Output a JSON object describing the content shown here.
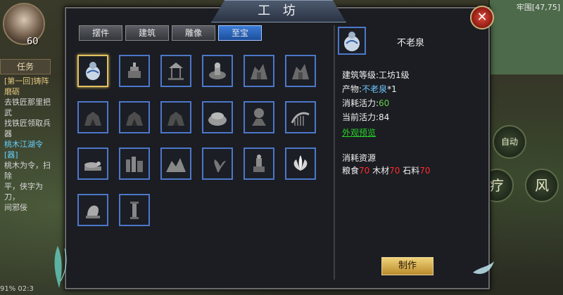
{
  "panel": {
    "title": "工 坊",
    "close_icon": "close-icon"
  },
  "tabs": [
    {
      "label": "摆件",
      "active": false
    },
    {
      "label": "建筑",
      "active": false
    },
    {
      "label": "雕像",
      "active": false
    },
    {
      "label": "至宝",
      "active": true
    }
  ],
  "items": [
    {
      "icon": "gourd-vase-icon",
      "selected": true
    },
    {
      "icon": "pagoda-icon"
    },
    {
      "icon": "pavilion-icon"
    },
    {
      "icon": "altar-icon"
    },
    {
      "icon": "ruin-icon"
    },
    {
      "icon": "ruin-icon"
    },
    {
      "icon": "dark-shrine-icon"
    },
    {
      "icon": "dark-shrine-icon"
    },
    {
      "icon": "dark-shrine-icon"
    },
    {
      "icon": "stone-mound-icon"
    },
    {
      "icon": "tree-rock-icon"
    },
    {
      "icon": "dragon-skeleton-icon"
    },
    {
      "icon": "reclining-statue-icon"
    },
    {
      "icon": "rock-cluster-icon"
    },
    {
      "icon": "mountain-icon"
    },
    {
      "icon": "twisted-tree-icon"
    },
    {
      "icon": "pillar-shrine-icon"
    },
    {
      "icon": "lotus-icon"
    },
    {
      "icon": "beast-statue-icon"
    },
    {
      "icon": "pillar-icon"
    }
  ],
  "detail": {
    "name": "不老泉",
    "level_label": "建筑等级:",
    "level_value": "工坊1级",
    "product_label": "产物:",
    "product_value": "不老泉",
    "product_count": "*1",
    "consume_label": "消耗活力:",
    "consume_value": "60",
    "current_label": "当前活力:",
    "current_value": "84",
    "preview": "外观预览",
    "resources_title": "消耗资源",
    "res1_label": "粮食",
    "res1_value": "70",
    "res2_label": "木材",
    "res2_value": "70",
    "res3_label": "石料",
    "res3_value": "70",
    "make_button": "制作"
  },
  "hud": {
    "level": "60",
    "side_tab": "任务",
    "quest_line1": "[第一回]铸阵磨砺",
    "quest_line2": "去铁匠那里把武",
    "quest_line3": "找铁匠领取兵器",
    "quest_line4": "桃木江湖令[器]",
    "quest_line5": "桃木为令，扫除",
    "quest_line6": "平，侠字为刀，",
    "quest_line7": "间邪佞",
    "map_coord": "牢围[47,75]",
    "skill_auto": "自动",
    "skill_1": "疗",
    "skill_2": "风",
    "bottom": "91%  02:3"
  },
  "colors": {
    "accent_blue": "#4d77c9",
    "selected_gold": "#e0c060",
    "red": "#ff2a2a",
    "green": "#61d04a"
  }
}
